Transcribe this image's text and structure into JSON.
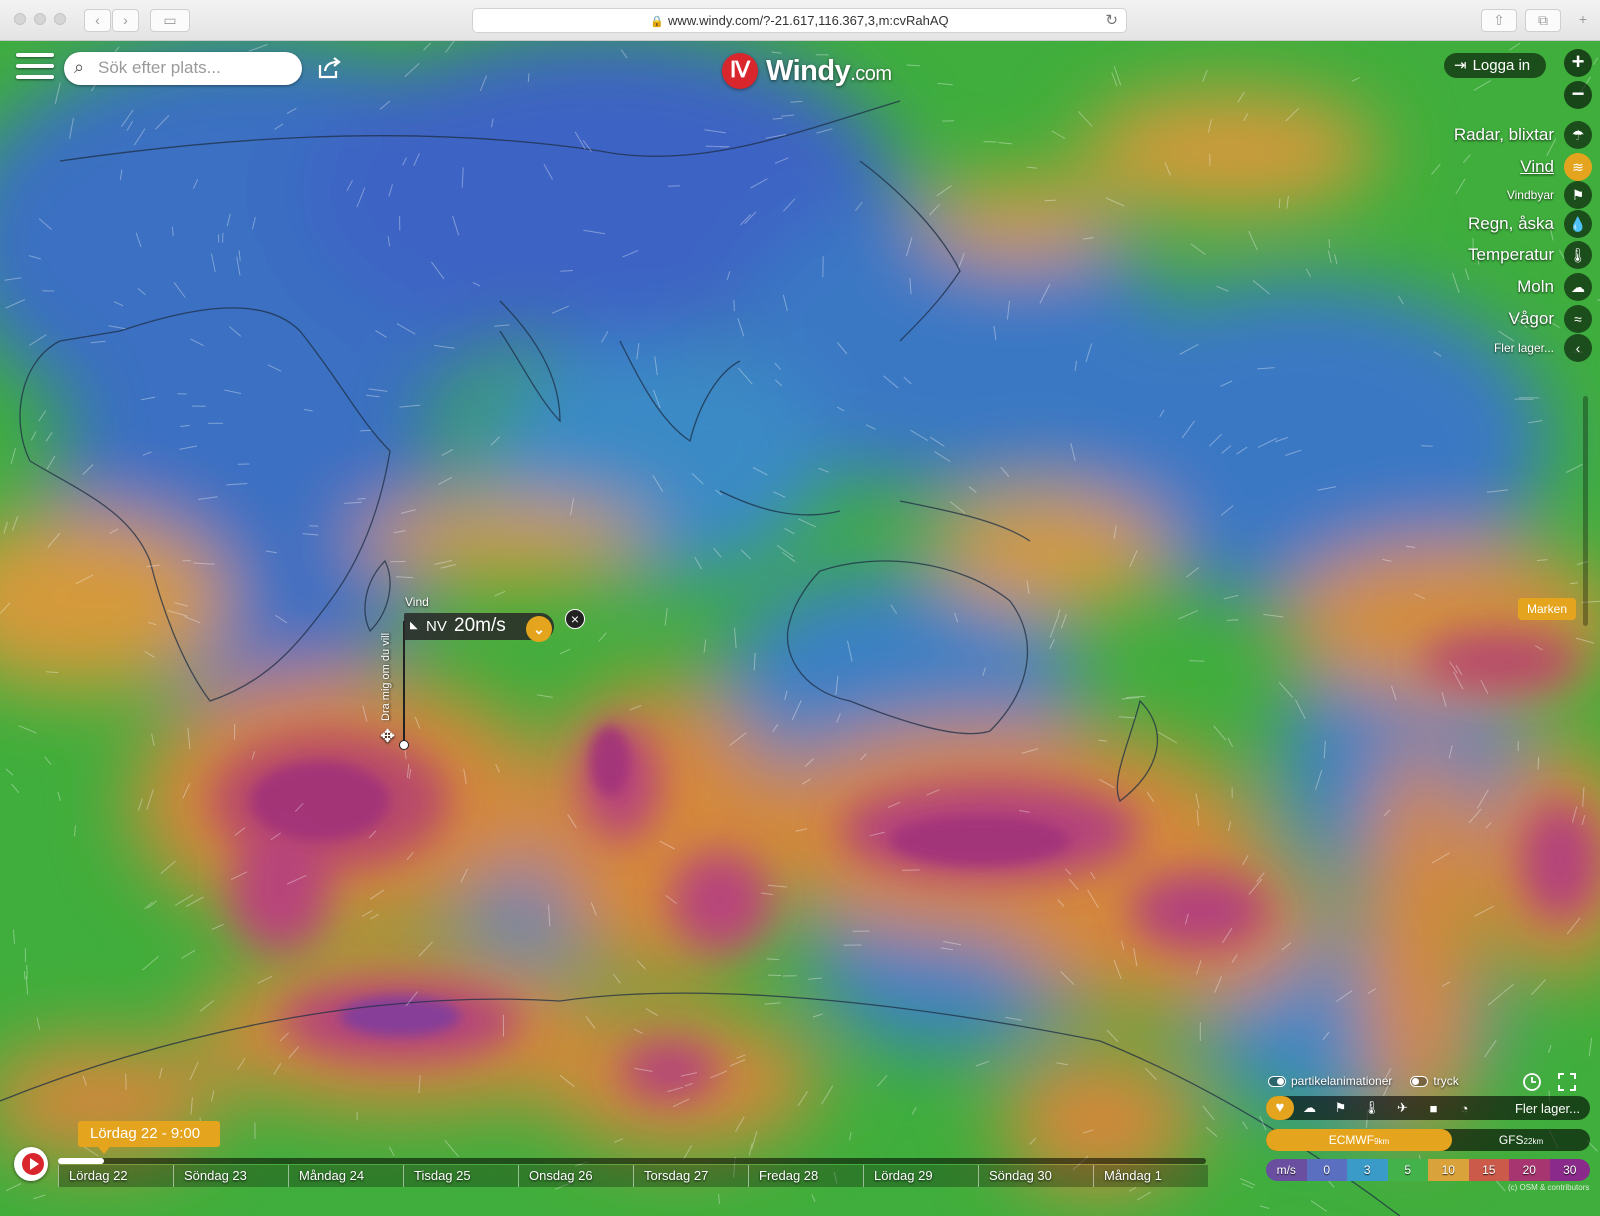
{
  "browser": {
    "url": "www.windy.com/?-21.617,116.367,3,m:cvRahAQ"
  },
  "app": {
    "logo_name": "Windy",
    "logo_domain": ".com",
    "search_placeholder": "Sök efter plats...",
    "login_label": "Logga in",
    "zoom_in": "+",
    "zoom_out": "−"
  },
  "layers": [
    {
      "label": "Radar, blixtar",
      "icon": "radar-icon",
      "active": false
    },
    {
      "label": "Vind",
      "icon": "wind-icon",
      "active": true
    },
    {
      "label": "Vindbyar",
      "icon": "gust-flag-icon",
      "active": false
    },
    {
      "label": "Regn, åska",
      "icon": "rain-drop-icon",
      "active": false
    },
    {
      "label": "Temperatur",
      "icon": "thermometer-icon",
      "active": false
    },
    {
      "label": "Moln",
      "icon": "cloud-icon",
      "active": false
    },
    {
      "label": "Vågor",
      "icon": "waves-icon",
      "active": false
    },
    {
      "label": "Fler lager...",
      "icon": "chevron-left-icon",
      "active": false
    }
  ],
  "marken_label": "Marken",
  "picker": {
    "layer_label": "Vind",
    "direction": "NV",
    "speed": "20m/s",
    "drag_hint": "Dra mig om du vill"
  },
  "overlay_toggles": {
    "particles": "partikelanimationer",
    "pressure": "tryck"
  },
  "quickbar_more": "Fler lager...",
  "models": {
    "primary": "ECMWF",
    "primary_res": "9km",
    "secondary": "GFS",
    "secondary_res": "22km"
  },
  "legend": {
    "unit": "m/s",
    "values": [
      "0",
      "3",
      "5",
      "10",
      "15",
      "20",
      "30"
    ],
    "colors": [
      "#6a4fa0",
      "#5a6fc0",
      "#3a9ac8",
      "#43b24a",
      "#d9a23a",
      "#cc5a4a",
      "#a7356f",
      "#8a2a8a"
    ]
  },
  "copyright": "(c) OSM & contributors",
  "timeline": {
    "current": "Lördag 22 - 9:00",
    "progress": 0.04,
    "days": [
      "Lördag 22",
      "Söndag 23",
      "Måndag 24",
      "Tisdag 25",
      "Onsdag 26",
      "Torsdag 27",
      "Fredag 28",
      "Lördag 29",
      "Söndag 30",
      "Måndag 1"
    ]
  },
  "colors": {
    "accent": "#e5a41d",
    "brand_red": "#d8262c"
  }
}
